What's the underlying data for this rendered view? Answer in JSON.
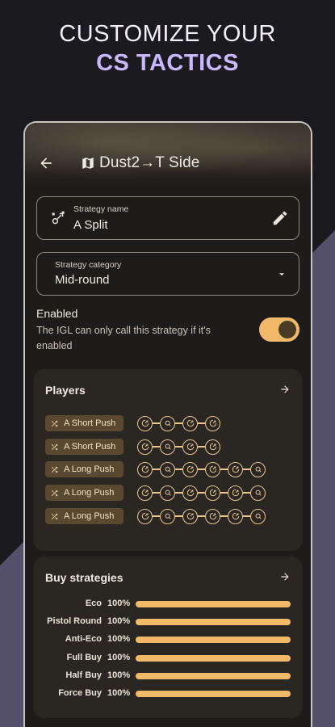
{
  "promo": {
    "line1": "CUSTOMIZE YOUR",
    "line2": "CS TACTICS"
  },
  "colors": {
    "accent": "#f2b968",
    "promo_highlight": "#c9b8ff",
    "chip": "#5a4931",
    "card": "#2a2722"
  },
  "appbar": {
    "back_icon": "arrow-left-icon",
    "map_icon": "map-icon",
    "title": "Dust2→T Side"
  },
  "strategy_name": {
    "label": "Strategy name",
    "value": "A Split",
    "leading_icon": "strategy-icon",
    "trailing_icon": "edit-icon"
  },
  "strategy_category": {
    "label": "Strategy category",
    "value": "Mid-round",
    "trailing_icon": "dropdown-icon"
  },
  "enabled": {
    "title": "Enabled",
    "description": "The IGL can only call this strategy if it's enabled",
    "on": true
  },
  "players": {
    "title": "Players",
    "rows": [
      {
        "label": "A Short Push",
        "steps": 4
      },
      {
        "label": "A Short Push",
        "steps": 4
      },
      {
        "label": "A Long Push",
        "steps": 6
      },
      {
        "label": "A Long Push",
        "steps": 6
      },
      {
        "label": "A Long Push",
        "steps": 6
      }
    ]
  },
  "buy": {
    "title": "Buy strategies",
    "rows": [
      {
        "label": "Eco",
        "percent": "100%",
        "value": 1.0
      },
      {
        "label": "Pistol Round",
        "percent": "100%",
        "value": 1.0
      },
      {
        "label": "Anti-Eco",
        "percent": "100%",
        "value": 1.0
      },
      {
        "label": "Full Buy",
        "percent": "100%",
        "value": 1.0
      },
      {
        "label": "Half Buy",
        "percent": "100%",
        "value": 1.0
      },
      {
        "label": "Force Buy",
        "percent": "100%",
        "value": 1.0
      }
    ]
  }
}
